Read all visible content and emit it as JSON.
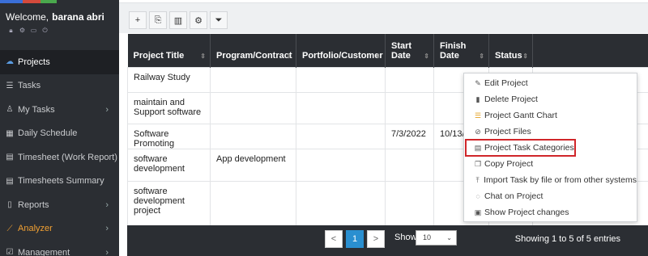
{
  "sidebar": {
    "welcome_prefix": "Welcome,",
    "user_name": "barana abri",
    "topbar_colors": [
      "#3a6fd8",
      "#d34a3c",
      "#4aa84d"
    ],
    "user_icons": [
      "lock-icon",
      "gear-icon",
      "id-card-icon",
      "power-icon"
    ],
    "items": [
      {
        "label": "Projects",
        "icon": "projects-icon"
      },
      {
        "label": "Tasks",
        "icon": "list-icon"
      },
      {
        "label": "My Tasks",
        "icon": "person-icon"
      },
      {
        "label": "Daily Schedule",
        "icon": "calendar-grid-icon"
      },
      {
        "label": "Timesheet (Work Report)",
        "icon": "calendar-icon"
      },
      {
        "label": "Timesheets Summary",
        "icon": "table-icon"
      },
      {
        "label": "Reports",
        "icon": "file-icon"
      },
      {
        "label": "Analyzer",
        "icon": "magic-wand-icon"
      },
      {
        "label": "Management",
        "icon": "check-square-icon"
      }
    ]
  },
  "toolbar": {
    "buttons": [
      {
        "icon": "plus-icon",
        "glyph": "+"
      },
      {
        "icon": "excel-export-icon",
        "glyph": "⎘"
      },
      {
        "icon": "columns-icon",
        "glyph": "▥"
      },
      {
        "icon": "gear-icon",
        "glyph": "⚙"
      },
      {
        "icon": "filter-icon",
        "glyph": "⏷"
      }
    ]
  },
  "table": {
    "headers": {
      "title": "Project Title",
      "program": "Program/Contract",
      "portfolio": "Portfolio/Customer",
      "start": "Start Date",
      "finish": "Finish Date",
      "status": "Status"
    },
    "rows": [
      {
        "title": "Railway Study",
        "program": "",
        "portfolio": "",
        "start": "",
        "finish": "",
        "status": ""
      },
      {
        "title": "maintain and Support software",
        "program": "",
        "portfolio": "",
        "start": "",
        "finish": "",
        "status": ""
      },
      {
        "title": "Software Promoting",
        "program": "",
        "portfolio": "",
        "start": "7/3/2022",
        "finish": "10/13/",
        "status": ""
      },
      {
        "title": "software development",
        "program": "App development",
        "portfolio": "",
        "start": "",
        "finish": "",
        "status": ""
      },
      {
        "title": "software development project",
        "program": "",
        "portfolio": "",
        "start": "",
        "finish": "",
        "status": ""
      }
    ]
  },
  "context_menu": {
    "items": [
      {
        "label": "Edit Project",
        "icon": "edit-icon",
        "glyph": "✎"
      },
      {
        "label": "Delete Project",
        "icon": "trash-icon",
        "glyph": "🗑"
      },
      {
        "label": "Project Gantt Chart",
        "icon": "gantt-icon",
        "glyph": "☰"
      },
      {
        "label": "Project Files",
        "icon": "paperclip-icon",
        "glyph": "📎"
      },
      {
        "label": "Project Task Categories",
        "icon": "list-alt-icon",
        "glyph": "▤"
      },
      {
        "label": "Copy Project",
        "icon": "copy-icon",
        "glyph": "⎘"
      },
      {
        "label": "Import Task by file or from other systems",
        "icon": "upload-icon",
        "glyph": "⤒"
      },
      {
        "label": "Chat on Project",
        "icon": "chat-icon",
        "glyph": "💬"
      },
      {
        "label": "Show Project changes",
        "icon": "history-icon",
        "glyph": "▣"
      }
    ],
    "highlighted_index": 4,
    "highlight_color": "#d0262a"
  },
  "footer": {
    "prev": "<",
    "current_page": "1",
    "next": ">",
    "show_label": "Show",
    "page_size": "10",
    "showing_text": "Showing 1 to 5 of 5 entries"
  }
}
